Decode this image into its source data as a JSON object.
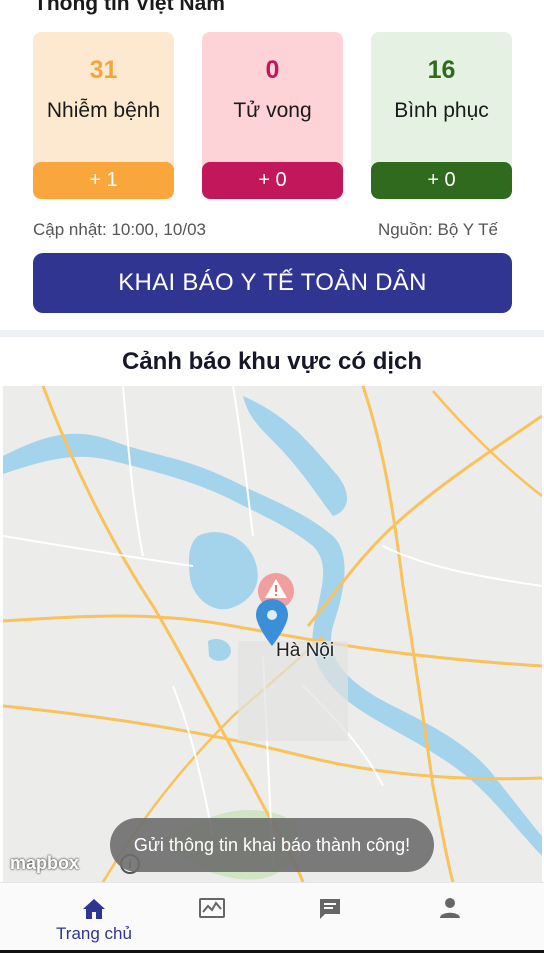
{
  "header": {
    "title": "Thông tin Việt Nam"
  },
  "stats": {
    "infected": {
      "value": "31",
      "label": "Nhiễm bệnh",
      "delta": "+ 1"
    },
    "deaths": {
      "value": "0",
      "label": "Tử vong",
      "delta": "+ 0"
    },
    "recovered": {
      "value": "16",
      "label": "Bình phục",
      "delta": "+ 0"
    }
  },
  "meta": {
    "updated": "Cập nhật: 10:00, 10/03",
    "source": "Nguồn: Bộ Y Tế"
  },
  "declare_button": {
    "label": "KHAI BÁO Y TẾ TOÀN DÂN"
  },
  "map": {
    "title": "Cảnh báo khu vực có dịch",
    "city": "Hà Nội",
    "logo": "mapbox",
    "info": "i"
  },
  "toast": {
    "message": "Gửi thông tin khai báo thành công!"
  },
  "tabbar": {
    "tabs": [
      {
        "label": "Trang chủ",
        "icon": "home-icon",
        "active": true
      },
      {
        "label": "",
        "icon": "stats-icon"
      },
      {
        "label": "",
        "icon": "news-icon"
      },
      {
        "label": "",
        "icon": "profile-icon"
      }
    ]
  },
  "colors": {
    "primary": "#303592",
    "infected": "#f9a73d",
    "death": "#c2185b",
    "recovered": "#306a1e"
  }
}
